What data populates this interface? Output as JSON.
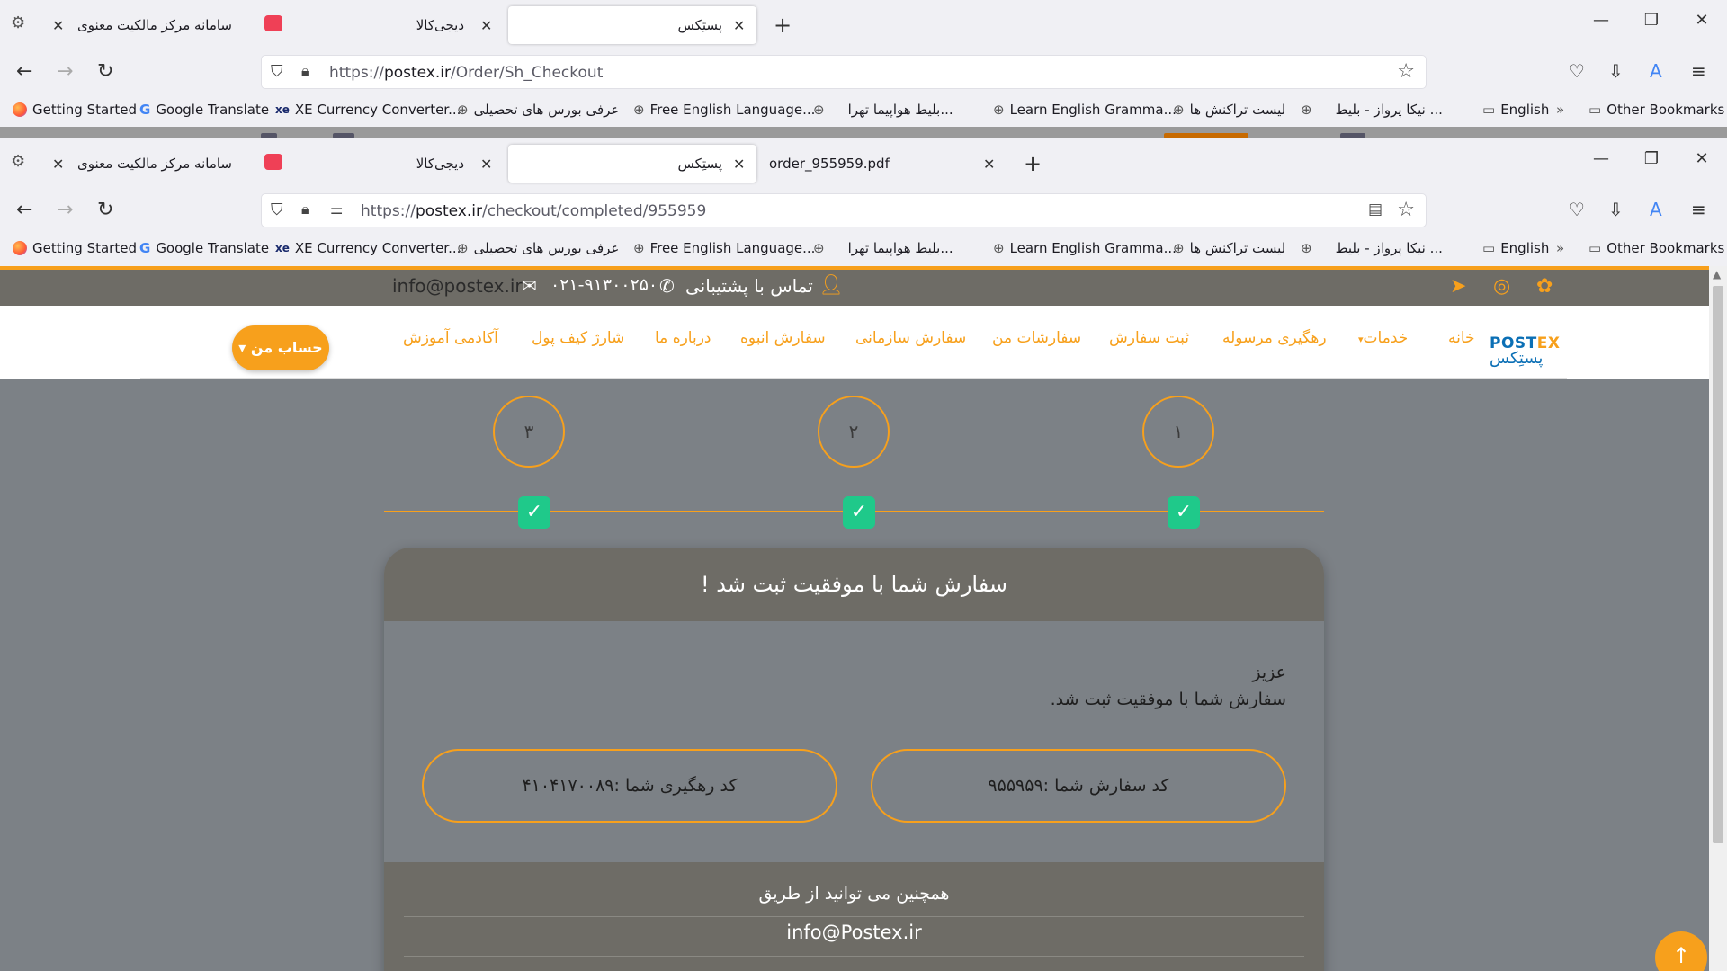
{
  "window1": {
    "tabs": [
      {
        "label": "سامانه مرکز مالکیت معنوی"
      },
      {
        "label": "دیجی‌کالا"
      },
      {
        "label": "پستِکس",
        "active": true
      }
    ],
    "url_base": "https://",
    "url_host": "postex.ir",
    "url_path": "/Order/Sh_Checkout"
  },
  "window2": {
    "tabs": [
      {
        "label": "سامانه مرکز مالکیت معنوی"
      },
      {
        "label": "دیجی‌کالا"
      },
      {
        "label": "پستِکس",
        "active": true
      },
      {
        "label": "order_955959.pdf"
      }
    ],
    "url_base": "https://",
    "url_host": "postex.ir",
    "url_path": "/checkout/completed/955959"
  },
  "bookmarks": [
    {
      "label": "Getting Started"
    },
    {
      "label": "Google Translate"
    },
    {
      "label": "XE Currency Converter..."
    },
    {
      "label": "عرفی بورس های تحصیلی"
    },
    {
      "label": "Free English Language..."
    },
    {
      "label": "بلیط هواپیما تهرا..."
    },
    {
      "label": "Learn English Gramma..."
    },
    {
      "label": "لیست تراکنش ها"
    },
    {
      "label": "نیکا پرواز - بلیط ..."
    },
    {
      "label": "English"
    },
    {
      "label": "Other Bookmarks"
    }
  ],
  "topbar": {
    "email": "info@postex.ir",
    "phone": "۰۲۱-۹۱۳۰۰۲۵۰",
    "contact": "تماس با پشتیبانی"
  },
  "nav": {
    "logo_en_1": "POST",
    "logo_en_2": "EX",
    "logo_fa": "پستِکس",
    "items": [
      {
        "label": "خانه"
      },
      {
        "label": "خدمات"
      },
      {
        "label": "رهگیری مرسوله"
      },
      {
        "label": "ثبت سفارش"
      },
      {
        "label": "سفارشات من"
      },
      {
        "label": "سفارش سازمانی"
      },
      {
        "label": "سفارش انبوه"
      },
      {
        "label": "درباره ما"
      },
      {
        "label": "شارژ کیف پول"
      },
      {
        "label": "آکادمی آموزش"
      }
    ],
    "account": "حساب من"
  },
  "steps": [
    "۱",
    "۲",
    "۳"
  ],
  "card": {
    "title": "سفارش شما با موفقیت ثبت شد !",
    "greet_1": "عزیز",
    "greet_2": "سفارش شما با موفقیت ثبت شد.",
    "order_code": "کد سفارش شما :۹۵۵۹۵۹",
    "tracking_code": "کد رهگیری شما :۴۱۰۴۱۷۰۰۸۹",
    "also": "همچنین می توانید از طریق",
    "email": "info@Postex.ir"
  },
  "colors": {
    "accent": "#f7a01c",
    "success": "#1fc98a",
    "brand_blue": "#0b6fb5"
  }
}
